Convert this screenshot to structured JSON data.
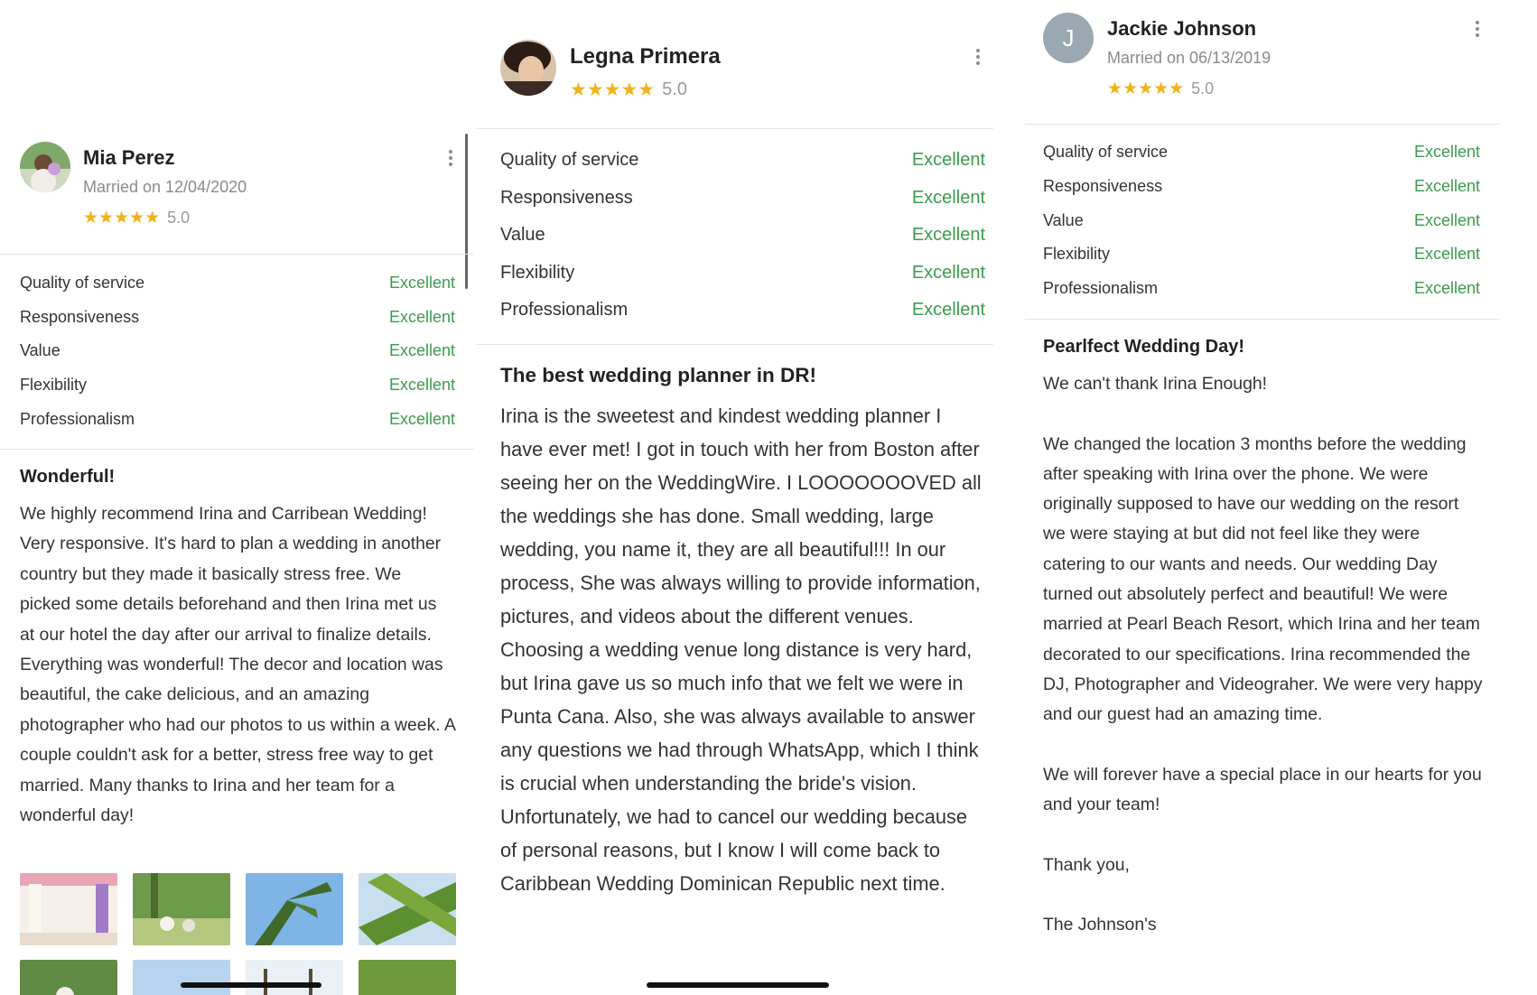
{
  "reviews": [
    {
      "name": "Mia Perez",
      "married": "Married on 12/04/2020",
      "stars": "★★★★★",
      "score": "5.0",
      "ratings": [
        {
          "label": "Quality of service",
          "value": "Excellent"
        },
        {
          "label": "Responsiveness",
          "value": "Excellent"
        },
        {
          "label": "Value",
          "value": "Excellent"
        },
        {
          "label": "Flexibility",
          "value": "Excellent"
        },
        {
          "label": "Professionalism",
          "value": "Excellent"
        }
      ],
      "title": "Wonderful!",
      "body": "We highly recommend Irina and Carribean Wedding! Very responsive. It's hard to plan a wedding in another country but they made it basically stress free. We picked some details beforehand and then Irina met us at our hotel the day after our arrival to finalize details. Everything was wonderful! The decor and location was beautiful, the cake delicious, and an amazing photographer who had our photos to us within a week. A couple couldn't ask for a better, stress free way to get married. Many thanks to Irina and her team for a wonderful day!"
    },
    {
      "name": "Legna Primera",
      "stars": "★★★★★",
      "score": "5.0",
      "ratings": [
        {
          "label": "Quality of service",
          "value": "Excellent"
        },
        {
          "label": "Responsiveness",
          "value": "Excellent"
        },
        {
          "label": "Value",
          "value": "Excellent"
        },
        {
          "label": "Flexibility",
          "value": "Excellent"
        },
        {
          "label": "Professionalism",
          "value": "Excellent"
        }
      ],
      "title": "The best wedding planner in DR!",
      "body": "Irina is the sweetest and kindest wedding planner I have ever met! I got in touch with her from Boston after seeing her on the WeddingWire. I LOOOOOOOVED all the weddings she has done. Small wedding, large wedding, you name it, they are all beautiful!!! In our process, She was always willing to provide information, pictures, and videos about the different venues. Choosing a wedding venue long distance is very hard, but Irina gave us so much info that we felt we were in Punta Cana. Also, she was always available to answer any questions we had through WhatsApp, which I think is crucial when understanding the bride's vision. Unfortunately, we had to cancel our wedding because of personal reasons, but I know I will come back to Caribbean Wedding Dominican Republic next time."
    },
    {
      "name": "Jackie Johnson",
      "initial": "J",
      "married": "Married on 06/13/2019",
      "stars": "★★★★★",
      "score": "5.0",
      "ratings": [
        {
          "label": "Quality of service",
          "value": "Excellent"
        },
        {
          "label": "Responsiveness",
          "value": "Excellent"
        },
        {
          "label": "Value",
          "value": "Excellent"
        },
        {
          "label": "Flexibility",
          "value": "Excellent"
        },
        {
          "label": "Professionalism",
          "value": "Excellent"
        }
      ],
      "title": "Pearlfect Wedding Day!",
      "body_paragraphs": [
        "We can't thank Irina Enough!",
        "We changed the location 3 months before the wedding after speaking with Irina over the phone. We were originally supposed to have our wedding on the resort we were staying at but did not feel like they were catering to our wants and needs. Our wedding Day turned out absolutely perfect and beautiful! We were married at Pearl Beach Resort, which Irina and her team decorated to our specifications. Irina recommended the DJ, Photographer and Videograher. We were very happy and our guest had an amazing time.",
        "We will forever have a special place in our hearts for you and your team!",
        "Thank you,",
        "The Johnson's"
      ]
    }
  ],
  "icons": {
    "more": "more-vertical-icon",
    "star": "star-icon"
  },
  "colors": {
    "excellent": "#3d9a4f",
    "star": "#f2b21a",
    "avatar_initial_bg": "#9aa8b1"
  }
}
